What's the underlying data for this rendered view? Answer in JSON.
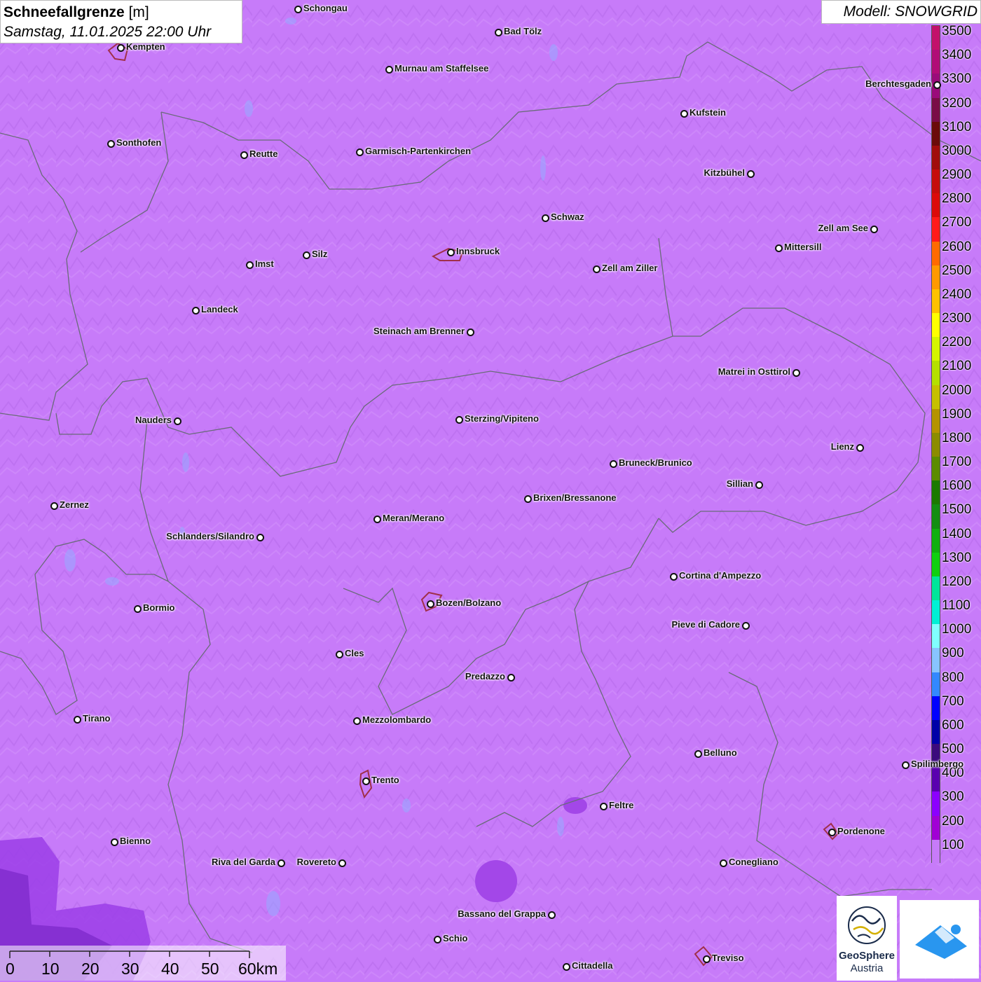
{
  "title": {
    "parameter": "Schneefallgrenze",
    "unit": "[m]",
    "datetime": "Samstag, 11.01.2025 22:00 Uhr"
  },
  "model": "Modell: SNOWGRID",
  "legend": {
    "labels": [
      "3500",
      "3400",
      "3300",
      "3200",
      "3100",
      "3000",
      "2900",
      "2800",
      "2700",
      "2600",
      "2500",
      "2400",
      "2300",
      "2200",
      "2100",
      "2000",
      "1900",
      "1800",
      "1700",
      "1600",
      "1500",
      "1400",
      "1300",
      "1200",
      "1100",
      "1000",
      "900",
      "800",
      "700",
      "600",
      "500",
      "400",
      "300",
      "200",
      "100"
    ],
    "colors": [
      "#c3106b",
      "#b10c77",
      "#9b0a7a",
      "#7a0c47",
      "#6b0a0a",
      "#a10c0c",
      "#c60c0c",
      "#dc0a0a",
      "#ff1a1a",
      "#ff6a00",
      "#ff9900",
      "#ffc100",
      "#ffff00",
      "#d5f500",
      "#b5e000",
      "#c6c000",
      "#b59300",
      "#8c8c00",
      "#5c8c00",
      "#1b7a00",
      "#138e13",
      "#10b010",
      "#10d010",
      "#00e59a",
      "#00f0d5",
      "#80ffff",
      "#88c4ff",
      "#3388ff",
      "#0000ff",
      "#0000a8",
      "#3b0a7d",
      "#5a00b0",
      "#8c00ff",
      "#a100d5",
      "#c77bf9"
    ]
  },
  "cities": [
    {
      "name": "Schongau"
    },
    {
      "name": "Bad Tölz"
    },
    {
      "name": "Kempten"
    },
    {
      "name": "Murnau am Staffelsee"
    },
    {
      "name": "Berchtesgaden"
    },
    {
      "name": "Kufstein"
    },
    {
      "name": "Sonthofen"
    },
    {
      "name": "Reutte"
    },
    {
      "name": "Garmisch-Partenkirchen"
    },
    {
      "name": "Kitzbühel"
    },
    {
      "name": "Schwaz"
    },
    {
      "name": "Zell am See"
    },
    {
      "name": "Innsbruck"
    },
    {
      "name": "Mittersill"
    },
    {
      "name": "Silz"
    },
    {
      "name": "Imst"
    },
    {
      "name": "Zell am Ziller"
    },
    {
      "name": "Landeck"
    },
    {
      "name": "Steinach am Brenner"
    },
    {
      "name": "Matrei in Osttirol"
    },
    {
      "name": "Nauders"
    },
    {
      "name": "Sterzing/Vipiteno"
    },
    {
      "name": "Lienz"
    },
    {
      "name": "Bruneck/Brunico"
    },
    {
      "name": "Sillian"
    },
    {
      "name": "Zernez"
    },
    {
      "name": "Brixen/Bressanone"
    },
    {
      "name": "Meran/Merano"
    },
    {
      "name": "Schlanders/Silandro"
    },
    {
      "name": "Cortina d'Ampezzo"
    },
    {
      "name": "Bozen/Bolzano"
    },
    {
      "name": "Bormio"
    },
    {
      "name": "Pieve di Cadore"
    },
    {
      "name": "Cles"
    },
    {
      "name": "Predazzo"
    },
    {
      "name": "Tirano"
    },
    {
      "name": "Mezzolombardo"
    },
    {
      "name": "Belluno"
    },
    {
      "name": "Spilimbergo"
    },
    {
      "name": "Trento"
    },
    {
      "name": "Feltre"
    },
    {
      "name": "Pordenone"
    },
    {
      "name": "Bienno"
    },
    {
      "name": "Riva del Garda"
    },
    {
      "name": "Rovereto"
    },
    {
      "name": "Conegliano"
    },
    {
      "name": "Bassano del Grappa"
    },
    {
      "name": "Schio"
    },
    {
      "name": "Treviso"
    },
    {
      "name": "Cittadella"
    }
  ],
  "scale": {
    "labels": [
      "0",
      "10",
      "20",
      "30",
      "40",
      "50",
      "60km"
    ]
  },
  "logo": {
    "name": "GeoSphere",
    "sub": "Austria"
  }
}
